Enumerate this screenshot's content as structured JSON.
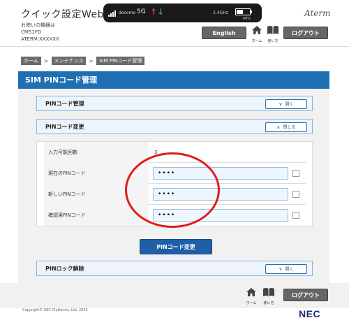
{
  "header": {
    "brand": "クイック設定Web",
    "device_label_line1": "お使いの機器は",
    "device_label_line2": "CM51FD",
    "device_label_line3": "ATERM-XXXXXX",
    "status": {
      "carrier": "docomo",
      "network": "5G",
      "up_arrow": "↑",
      "down_arrow": "↓",
      "small_text": "2.4GHz",
      "battery_pct": "49%",
      "battery_level": 0.49
    },
    "logo": "Aterm",
    "english_button": "English",
    "home_label": "ホーム",
    "manual_label": "使い方",
    "logout_button": "ログアウト"
  },
  "breadcrumb": [
    "ホーム",
    "メンテナンス",
    "SIM PINコード管理"
  ],
  "breadcrumb_sep": ">",
  "panel": {
    "title": "SIM PINコード管理",
    "sections": {
      "pin_manage": {
        "label": "PINコード管理",
        "button": "開く",
        "chevron": "∨"
      },
      "pin_change": {
        "label": "PINコード変更",
        "button": "閉じる",
        "chevron": "∧"
      },
      "pin_unlock": {
        "label": "PINロック解除",
        "button": "開く",
        "chevron": "∨"
      }
    },
    "form": {
      "attempts_label": "入力可能回数",
      "attempts_value": "3",
      "current_pin_label": "現在のPINコード",
      "current_pin_value": "••••",
      "new_pin_label": "新しいPINコード",
      "new_pin_value": "••••",
      "confirm_pin_label": "確認用PINコード",
      "confirm_pin_value": "••••"
    },
    "submit_button": "PINコード変更"
  },
  "footer": {
    "home_label": "ホーム",
    "manual_label": "使い方",
    "logout_button": "ログアウト",
    "copyright": "Copyright© NEC Platforms, Ltd. 2025",
    "brand": "NEC"
  },
  "colors": {
    "accent_blue": "#1f6fb5",
    "button_gray": "#666666",
    "annotation_red": "#e21b1b"
  }
}
